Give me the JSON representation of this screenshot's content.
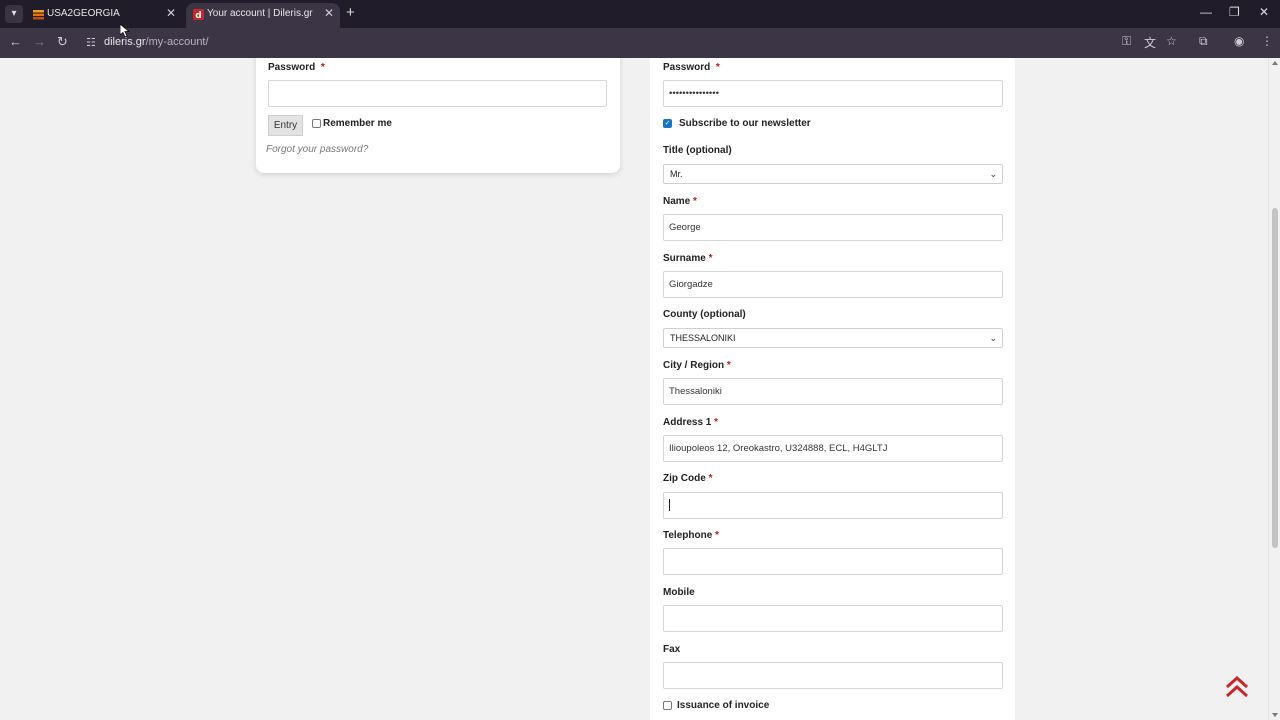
{
  "browser": {
    "tabs": [
      {
        "title": "USA2GEORGIA",
        "active": false
      },
      {
        "title": "Your account | Dileris.gr",
        "active": true
      }
    ],
    "url_host": "dileris.gr",
    "url_path": "/my-account/"
  },
  "login": {
    "password_label": "Password",
    "required_mark": "*",
    "entry_button": "Entry",
    "remember_label": "Remember me",
    "forgot_link": "Forgot your password?"
  },
  "register": {
    "password_label": "Password",
    "password_value": "•••••••••••••••",
    "newsletter_label": "Subscribe to our newsletter",
    "newsletter_checked": true,
    "title_label": "Title  (optional)",
    "title_value": "Mr.",
    "name_label": "Name",
    "name_value": "George",
    "surname_label": "Surname",
    "surname_value": "Giorgadze",
    "county_label": "County  (optional)",
    "county_value": "THESSALONIKI",
    "city_label": "City / Region",
    "city_value": "Thessaloniki",
    "address_label": "Address 1",
    "address_value": "Ilioupoleos 12, Oreokastro, U324888, ECL, H4GLTJ",
    "zip_label": "Zip Code",
    "zip_value": "",
    "telephone_label": "Telephone",
    "telephone_value": "",
    "mobile_label": "Mobile",
    "mobile_value": "",
    "fax_label": "Fax",
    "fax_value": "",
    "invoice_label": "Issuance of invoice",
    "invoice_checked": false
  },
  "colors": {
    "accent_required": "#c0151b",
    "scroll_top_icon": "#c62828",
    "checkbox_on": "#1a73c8"
  },
  "icons": [
    "tab-list-icon",
    "back-icon",
    "forward-icon",
    "reload-icon",
    "site-settings-icon",
    "password-key-icon",
    "translate-icon",
    "bookmark-star-icon",
    "extensions-icon",
    "profile-icon",
    "menu-icon",
    "scroll-to-top-icon"
  ]
}
